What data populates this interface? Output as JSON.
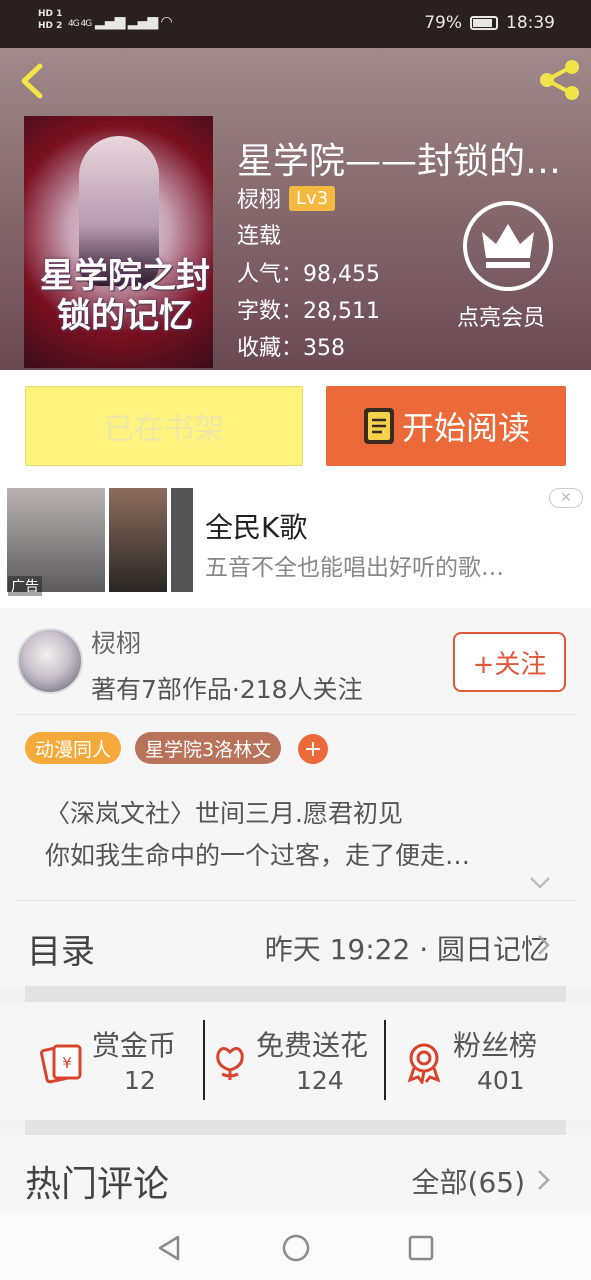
{
  "status_bar": {
    "sim1": "HD 1",
    "sim2": "HD 2",
    "network": "4G 4G",
    "battery": "79%",
    "battery_level": 0.79,
    "time": "18:39"
  },
  "book": {
    "title": "星学院——封锁的…",
    "cover_text": "星学院之封锁的记忆",
    "author": "棂栩",
    "level": "Lv3",
    "status": "连载",
    "popularity": "人气：98,455",
    "word_count": "字数：28,511",
    "favorites": "收藏：358",
    "vip_label": "点亮会员"
  },
  "actions": {
    "shelf_label": "已在书架",
    "read_label": "开始阅读"
  },
  "ad": {
    "title": "全民K歌",
    "description": "五音不全也能唱出好听的歌…",
    "tag": "广告",
    "close": "✕"
  },
  "author_section": {
    "name": "棂栩",
    "stats": "著有7部作品·218人关注",
    "follow_label": "+关注",
    "tags": [
      "动漫同人",
      "星学院3洛林文"
    ],
    "add_tag": "+",
    "desc_line1": "〈深岚文社〉世间三月.愿君初见",
    "desc_line2": "你如我生命中的一个过客，走了便走…"
  },
  "toc": {
    "label": "目录",
    "latest": "昨天 19:22 · 圆日记忆"
  },
  "stats": [
    {
      "label": "赏金币",
      "value": "12"
    },
    {
      "label": "免费送花",
      "value": "124"
    },
    {
      "label": "粉丝榜",
      "value": "401"
    }
  ],
  "comments": {
    "title": "热门评论",
    "all": "全部(65)"
  },
  "colors": {
    "accent_orange": "#ec6a3a",
    "shelf_yellow": "#fdf37d",
    "level_badge": "#f6b93f",
    "tag_orange": "#f5a93a",
    "tag_brown": "#b8735a",
    "icon_red": "#d8452f"
  },
  "icons": [
    "back-icon",
    "share-icon",
    "crown-icon",
    "book-icon",
    "coin-icon",
    "flower-icon",
    "medal-icon",
    "chevron-right-icon",
    "chevron-down-icon",
    "nav-back-icon",
    "nav-home-icon",
    "nav-recents-icon"
  ]
}
